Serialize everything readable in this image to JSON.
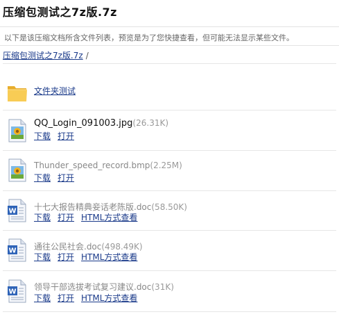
{
  "page": {
    "title": "压缩包测试之7z版.7z",
    "description": "以下是该压缩文档所含文件列表，预览是为了您快捷查看，但可能无法显示某些文件。"
  },
  "breadcrumb": {
    "link": "压缩包测试之7z版.7z",
    "separator": "/"
  },
  "folder": {
    "name": "文件夹测试",
    "icon": "folder-icon"
  },
  "files": [
    {
      "name": "QQ_Login_091003.jpg",
      "size": "(26.31K)",
      "icon": "image-file-icon",
      "actions": [
        "下载",
        "打开"
      ]
    },
    {
      "name": "Thunder_speed_record.bmp",
      "size": "(2.25M)",
      "icon": "image-file-icon",
      "actions": [
        "下载",
        "打开"
      ]
    },
    {
      "name": "十七大报告精典妾话老陈版.doc",
      "size": "(58.50K)",
      "icon": "word-document-icon",
      "actions": [
        "下载",
        "打开",
        "HTML方式查看"
      ]
    },
    {
      "name": "通往公民社会.doc",
      "size": "(498.49K)",
      "icon": "word-document-icon",
      "actions": [
        "下载",
        "打开",
        "HTML方式查看"
      ]
    },
    {
      "name": "领导干部选拔考试复习建议.doc",
      "size": "(31K)",
      "icon": "word-document-icon",
      "actions": [
        "下载",
        "打开",
        "HTML方式查看"
      ]
    }
  ],
  "colors": {
    "link": "#1a3a8a",
    "muted_text": "#888888",
    "folder": "#f4c542"
  }
}
